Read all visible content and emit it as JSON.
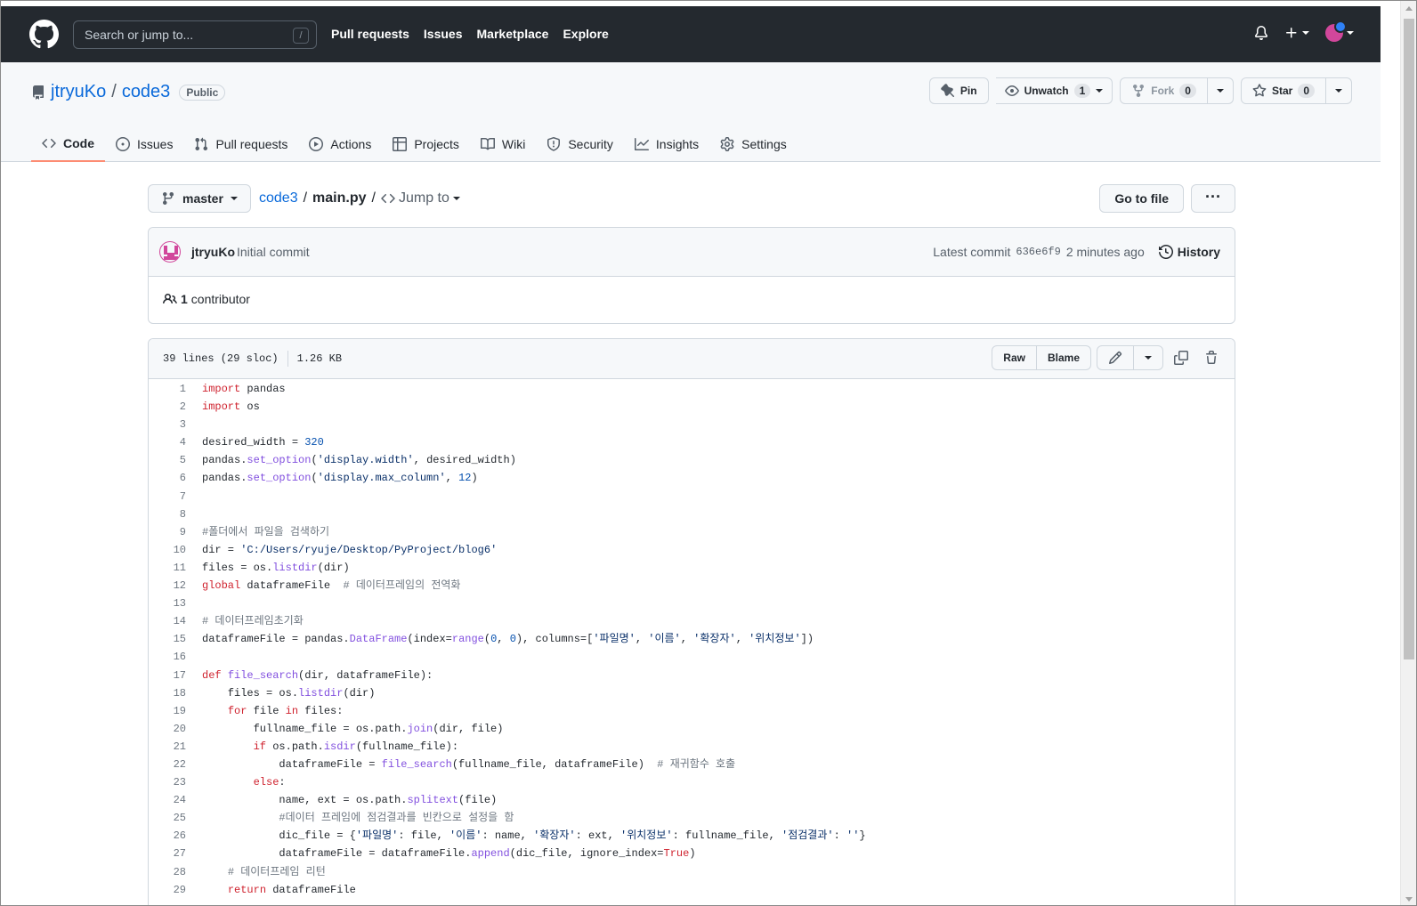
{
  "header": {
    "search_placeholder": "Search or jump to...",
    "search_shortcut": "/",
    "nav": [
      "Pull requests",
      "Issues",
      "Marketplace",
      "Explore"
    ]
  },
  "repo": {
    "owner": "jtryuKo",
    "separator": "/",
    "name": "code3",
    "visibility": "Public",
    "pin_label": "Pin",
    "unwatch_label": "Unwatch",
    "watch_count": "1",
    "fork_label": "Fork",
    "fork_count": "0",
    "star_label": "Star",
    "star_count": "0"
  },
  "tabs": [
    {
      "label": "Code",
      "icon": "code-icon"
    },
    {
      "label": "Issues",
      "icon": "issue-icon"
    },
    {
      "label": "Pull requests",
      "icon": "pull-request-icon"
    },
    {
      "label": "Actions",
      "icon": "play-icon"
    },
    {
      "label": "Projects",
      "icon": "table-icon"
    },
    {
      "label": "Wiki",
      "icon": "book-icon"
    },
    {
      "label": "Security",
      "icon": "shield-icon"
    },
    {
      "label": "Insights",
      "icon": "graph-icon"
    },
    {
      "label": "Settings",
      "icon": "gear-icon"
    }
  ],
  "file_nav": {
    "branch": "master",
    "crumb_repo": "code3",
    "crumb_sep": "/",
    "crumb_file": "main.py",
    "jump_label": "Jump to",
    "goto_label": "Go to file",
    "more_label": "···"
  },
  "commit": {
    "author": "jtryuKo",
    "message": "Initial commit",
    "latest_label": "Latest commit",
    "sha": "636e6f9",
    "time": "2 minutes ago",
    "history_label": "History",
    "contributors_count": "1",
    "contributors_label": "contributor"
  },
  "file": {
    "lines_info": "39 lines (29 sloc)",
    "size": "1.26 KB",
    "raw_label": "Raw",
    "blame_label": "Blame"
  },
  "code_lines": [
    "import pandas",
    "import os",
    "",
    "desired_width = 320",
    "pandas.set_option('display.width', desired_width)",
    "pandas.set_option('display.max_column', 12)",
    "",
    "",
    "#폴더에서 파일을 검색하기",
    "dir = 'C:/Users/ryuje/Desktop/PyProject/blog6'",
    "files = os.listdir(dir)",
    "global dataframeFile  # 데이터프레임의 전역화",
    "",
    "# 데이터프레임초기화",
    "dataframeFile = pandas.DataFrame(index=range(0, 0), columns=['파일명', '이름', '확장자', '위치정보'])",
    "",
    "def file_search(dir, dataframeFile):",
    "    files = os.listdir(dir)",
    "    for file in files:",
    "        fullname_file = os.path.join(dir, file)",
    "        if os.path.isdir(fullname_file):",
    "            dataframeFile = file_search(fullname_file, dataframeFile)  # 재귀함수 호출",
    "        else:",
    "            name, ext = os.path.splitext(file)",
    "            #데이터 프레임에 점검결과를 빈칸으로 설정을 함",
    "            dic_file = {'파일명': file, '이름': name, '확장자': ext, '위치정보': fullname_file, '점검결과': ''}",
    "            dataframeFile = dataframeFile.append(dic_file, ignore_index=True)",
    "    # 데이터프레임 리턴",
    "    return dataframeFile"
  ],
  "colors": {
    "header_bg": "#24292f",
    "link": "#0969da",
    "active_tab_underline": "#fd8c73",
    "keyword": "#cf222e",
    "function": "#8250df",
    "string": "#0a3069",
    "number": "#0550ae"
  }
}
